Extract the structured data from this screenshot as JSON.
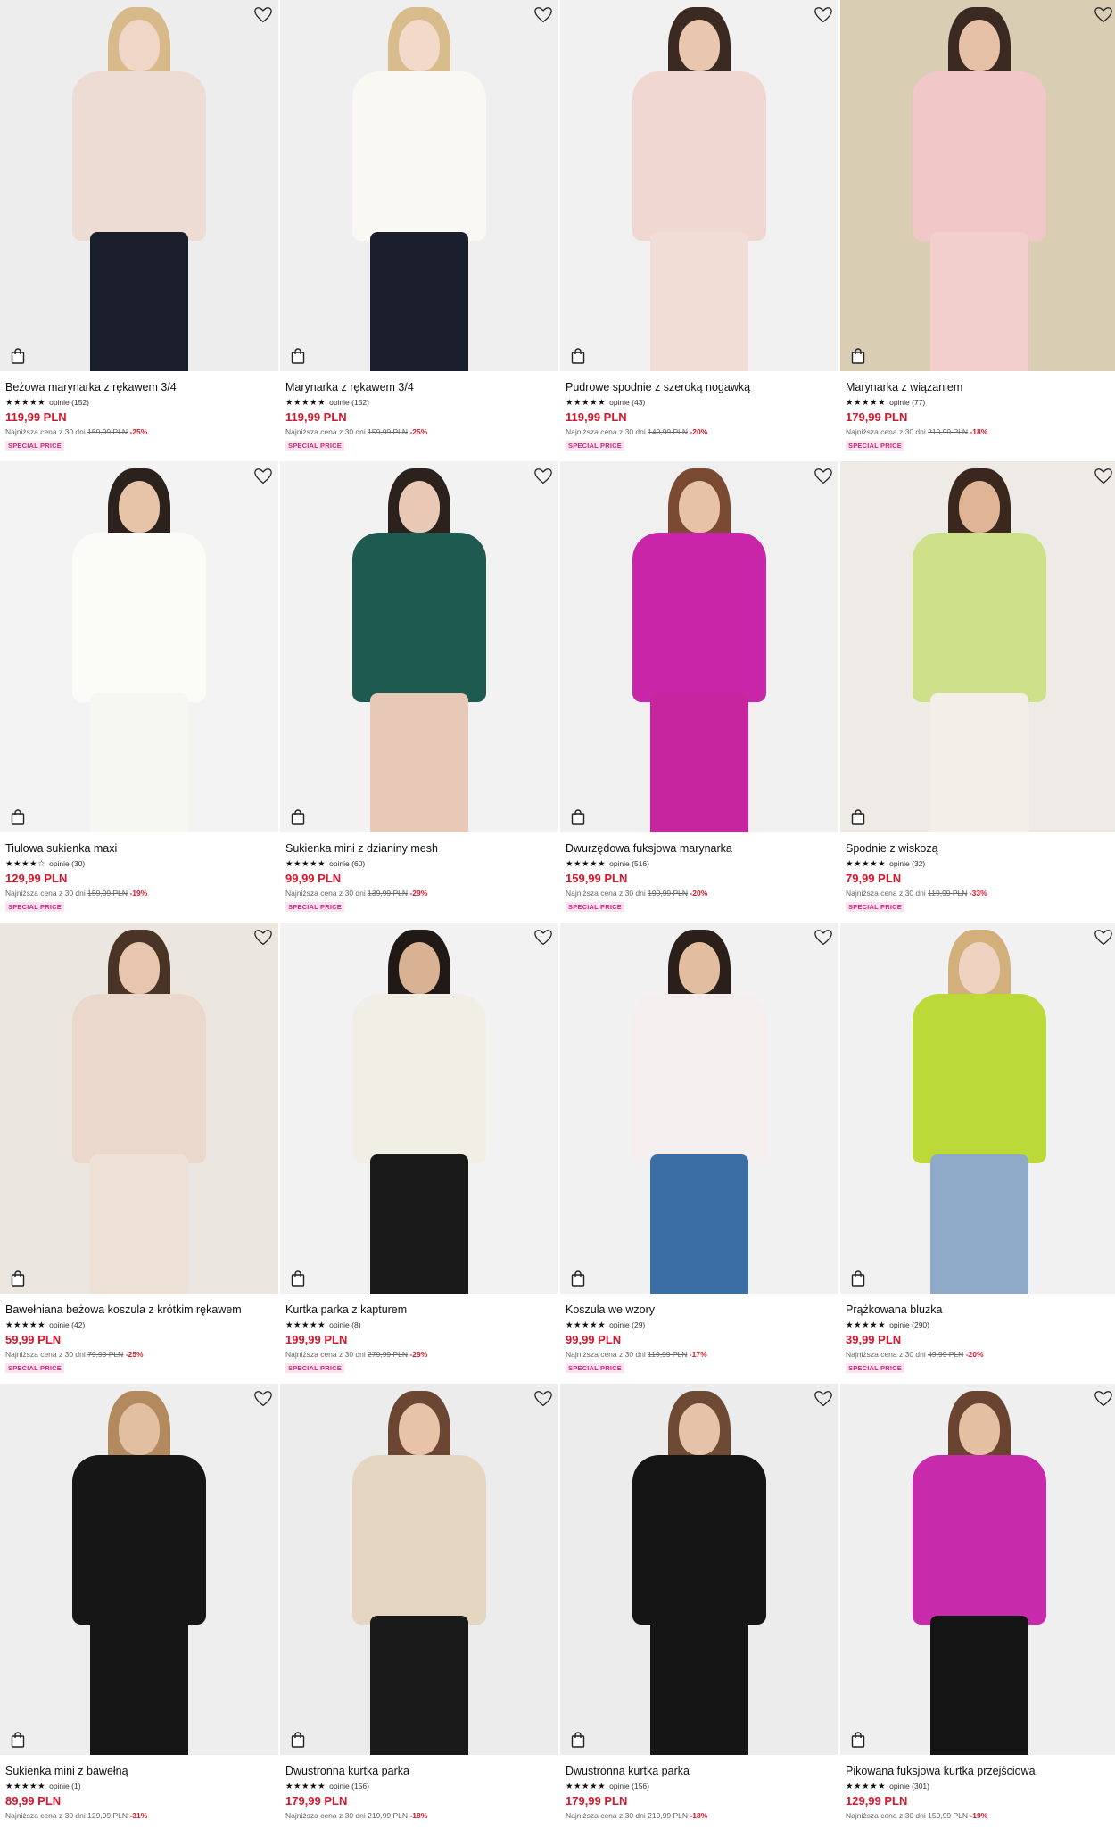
{
  "products": [
    {
      "name": "Beżowa marynarka z rękawem 3/4",
      "stars": "★★★★★",
      "opinie": "opinie (152)",
      "price": "119,99 PLN",
      "lowest_prefix": "Najniższa cena z 30 dni",
      "old_price": "159,99 PLN",
      "discount": "-25%",
      "badge": "SPECIAL PRICE",
      "bg": "#ededed",
      "top": "#ecdcd4",
      "bottom": "#1a1d2a",
      "hair": "#d7b98a",
      "skin": "#f0d6c6"
    },
    {
      "name": "Marynarka z rękawem 3/4",
      "stars": "★★★★★",
      "opinie": "opinie (152)",
      "price": "119,99 PLN",
      "lowest_prefix": "Najniższa cena z 30 dni",
      "old_price": "159,99 PLN",
      "discount": "-25%",
      "badge": "SPECIAL PRICE",
      "bg": "#efefef",
      "top": "#faf8f2",
      "bottom": "#1b1f2d",
      "hair": "#d8bc8c",
      "skin": "#f2d9c9"
    },
    {
      "name": "Pudrowe spodnie z szeroką nogawką",
      "stars": "★★★★★",
      "opinie": "opinie (43)",
      "price": "119,99 PLN",
      "lowest_prefix": "Najniższa cena z 30 dni",
      "old_price": "149,99 PLN",
      "discount": "-20%",
      "badge": "SPECIAL PRICE",
      "bg": "#f1f1f1",
      "top": "#f0d7d1",
      "bottom": "#f2ddd6",
      "hair": "#3b2a22",
      "skin": "#e9c6ae"
    },
    {
      "name": "Marynarka z wiązaniem",
      "stars": "★★★★★",
      "opinie": "opinie (77)",
      "price": "179,99 PLN",
      "lowest_prefix": "Najniższa cena z 30 dni",
      "old_price": "219,99 PLN",
      "discount": "-18%",
      "badge": "SPECIAL PRICE",
      "bg": "#d9cdb3",
      "top": "#f1c7c7",
      "bottom": "#f2cfcd",
      "hair": "#3a2a22",
      "skin": "#e6c1a7"
    },
    {
      "name": "Tiulowa sukienka maxi",
      "stars": "★★★★☆",
      "opinie": "opinie (30)",
      "price": "129,99 PLN",
      "lowest_prefix": "Najniższa cena z 30 dni",
      "old_price": "159,99 PLN",
      "discount": "-19%",
      "badge": "SPECIAL PRICE",
      "bg": "#f3f3f3",
      "top": "#fbfbf8",
      "bottom": "#f6f6f2",
      "hair": "#2b211d",
      "skin": "#e7c3a8"
    },
    {
      "name": "Sukienka mini z dzianiny mesh",
      "stars": "★★★★★",
      "opinie": "opinie (60)",
      "price": "99,99 PLN",
      "lowest_prefix": "Najniższa cena z 30 dni",
      "old_price": "139,99 PLN",
      "discount": "-29%",
      "badge": "SPECIAL PRICE",
      "bg": "#f2f2f2",
      "top": "#1f5a51",
      "bottom": "#e8c8b6",
      "hair": "#2b221e",
      "skin": "#e9c9b5"
    },
    {
      "name": "Dwurzędowa fuksjowa marynarka",
      "stars": "★★★★★",
      "opinie": "opinie (516)",
      "price": "159,99 PLN",
      "lowest_prefix": "Najniższa cena z 30 dni",
      "old_price": "199,99 PLN",
      "discount": "-20%",
      "badge": "SPECIAL PRICE",
      "bg": "#f0f0f0",
      "top": "#c925a9",
      "bottom": "#c7259f",
      "hair": "#7a4a33",
      "skin": "#e8c2a6"
    },
    {
      "name": "Spodnie z wiskozą",
      "stars": "★★★★★",
      "opinie": "opinie (32)",
      "price": "79,99 PLN",
      "lowest_prefix": "Najniższa cena z 30 dni",
      "old_price": "119,99 PLN",
      "discount": "-33%",
      "badge": "SPECIAL PRICE",
      "bg": "#eeeae6",
      "top": "#cfe08a",
      "bottom": "#f3efe8",
      "hair": "#3a281f",
      "skin": "#dfb596"
    },
    {
      "name": "Bawełniana beżowa koszula z krótkim rękawem",
      "stars": "★★★★★",
      "opinie": "opinie (42)",
      "price": "59,99 PLN",
      "lowest_prefix": "Najniższa cena z 30 dni",
      "old_price": "79,99 PLN",
      "discount": "-25%",
      "badge": "SPECIAL PRICE",
      "bg": "#ece6e0",
      "top": "#ead8cc",
      "bottom": "#eee1d6",
      "hair": "#4a3428",
      "skin": "#e7c6ad"
    },
    {
      "name": "Kurtka parka z kapturem",
      "stars": "★★★★★",
      "opinie": "opinie (8)",
      "price": "199,99 PLN",
      "lowest_prefix": "Najniższa cena z 30 dni",
      "old_price": "279,99 PLN",
      "discount": "-29%",
      "badge": "SPECIAL PRICE",
      "bg": "#f2f2f2",
      "top": "#f1eee6",
      "bottom": "#1a1a1a",
      "hair": "#211916",
      "skin": "#d9b293"
    },
    {
      "name": "Koszula we wzory",
      "stars": "★★★★★",
      "opinie": "opinie (29)",
      "price": "99,99 PLN",
      "lowest_prefix": "Najniższa cena z 30 dni",
      "old_price": "119,99 PLN",
      "discount": "-17%",
      "badge": "SPECIAL PRICE",
      "bg": "#f1f1f1",
      "top": "#f4eeee",
      "bottom": "#3a6ea5",
      "hair": "#2a1f1b",
      "skin": "#e3bd9f"
    },
    {
      "name": "Prążkowana bluzka",
      "stars": "★★★★★",
      "opinie": "opinie (290)",
      "price": "39,99 PLN",
      "lowest_prefix": "Najniższa cena z 30 dni",
      "old_price": "49,99 PLN",
      "discount": "-20%",
      "badge": "SPECIAL PRICE",
      "bg": "#f1f1f1",
      "top": "#bcd93a",
      "bottom": "#8fa9c8",
      "hair": "#d3b07b",
      "skin": "#efd2bf"
    },
    {
      "name": "Sukienka mini z bawełną",
      "stars": "★★★★★",
      "opinie": "opinie (1)",
      "price": "89,99 PLN",
      "lowest_prefix": "Najniższa cena z 30 dni",
      "old_price": "129,99 PLN",
      "discount": "-31%",
      "badge": "",
      "bg": "#eeeeee",
      "top": "#161616",
      "bottom": "#161616",
      "hair": "#b28a5e",
      "skin": "#e3bfa2"
    },
    {
      "name": "Dwustronna kurtka parka",
      "stars": "★★★★★",
      "opinie": "opinie (156)",
      "price": "179,99 PLN",
      "lowest_prefix": "Najniższa cena z 30 dni",
      "old_price": "219,99 PLN",
      "discount": "-18%",
      "badge": "",
      "bg": "#ececec",
      "top": "#e5d6c1",
      "bottom": "#1a1a1a",
      "hair": "#6b4632",
      "skin": "#e7c4a9"
    },
    {
      "name": "Dwustronna kurtka parka",
      "stars": "★★★★★",
      "opinie": "opinie (156)",
      "price": "179,99 PLN",
      "lowest_prefix": "Najniższa cena z 30 dni",
      "old_price": "219,99 PLN",
      "discount": "-18%",
      "badge": "",
      "bg": "#ececec",
      "top": "#151515",
      "bottom": "#151515",
      "hair": "#6e4a35",
      "skin": "#e6c3a8"
    },
    {
      "name": "Pikowana fuksjowa kurtka przejściowa",
      "stars": "★★★★★",
      "opinie": "opinie (301)",
      "price": "129,99 PLN",
      "lowest_prefix": "Najniższa cena z 30 dni",
      "old_price": "159,99 PLN",
      "discount": "-19%",
      "badge": "",
      "bg": "#efefef",
      "top": "#c72aab",
      "bottom": "#141414",
      "hair": "#6a4431",
      "skin": "#e4bfa2"
    }
  ]
}
